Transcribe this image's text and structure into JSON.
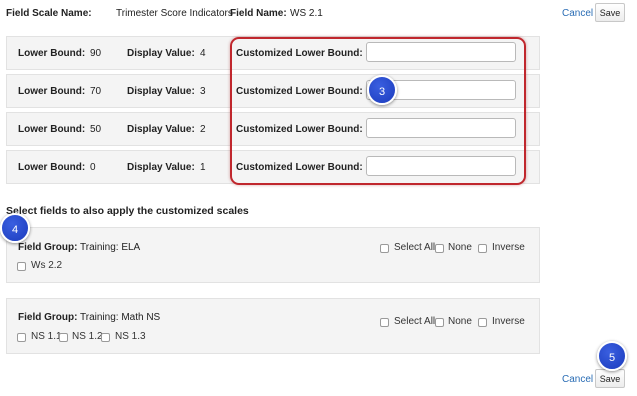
{
  "header": {
    "field_scale_label": "Field Scale Name:",
    "field_scale_value": "Trimester Score Indicators",
    "field_name_label": "Field Name:",
    "field_name_value": "WS 2.1",
    "cancel": "Cancel",
    "save": "Save"
  },
  "rows": [
    {
      "lower_label": "Lower Bound:",
      "lower": "90",
      "display_label": "Display Value:",
      "display": "4",
      "custom_label": "Customized Lower Bound:",
      "custom_value": ""
    },
    {
      "lower_label": "Lower Bound:",
      "lower": "70",
      "display_label": "Display Value:",
      "display": "3",
      "custom_label": "Customized Lower Bound:",
      "custom_value": ""
    },
    {
      "lower_label": "Lower Bound:",
      "lower": "50",
      "display_label": "Display Value:",
      "display": "2",
      "custom_label": "Customized Lower Bound:",
      "custom_value": ""
    },
    {
      "lower_label": "Lower Bound:",
      "lower": "0",
      "display_label": "Display Value:",
      "display": "1",
      "custom_label": "Customized Lower Bound:",
      "custom_value": ""
    }
  ],
  "apply_heading": "Select fields to also apply the customized scales",
  "groups": [
    {
      "label": "Field Group:",
      "name": "Training: ELA",
      "select_all": "Select All",
      "none": "None",
      "inverse": "Inverse",
      "fields": [
        "Ws 2.2"
      ]
    },
    {
      "label": "Field Group:",
      "name": "Training: Math NS",
      "select_all": "Select All",
      "none": "None",
      "inverse": "Inverse",
      "fields": [
        "NS 1.1",
        "NS 1.2",
        "NS 1.3"
      ]
    }
  ],
  "footer": {
    "cancel": "Cancel",
    "save": "Save"
  },
  "callouts": {
    "step3": "3",
    "step4": "4",
    "step5": "5"
  },
  "colors": {
    "link": "#2a6db5",
    "callout": "#1f40c8",
    "highlight": "#c0272d"
  }
}
